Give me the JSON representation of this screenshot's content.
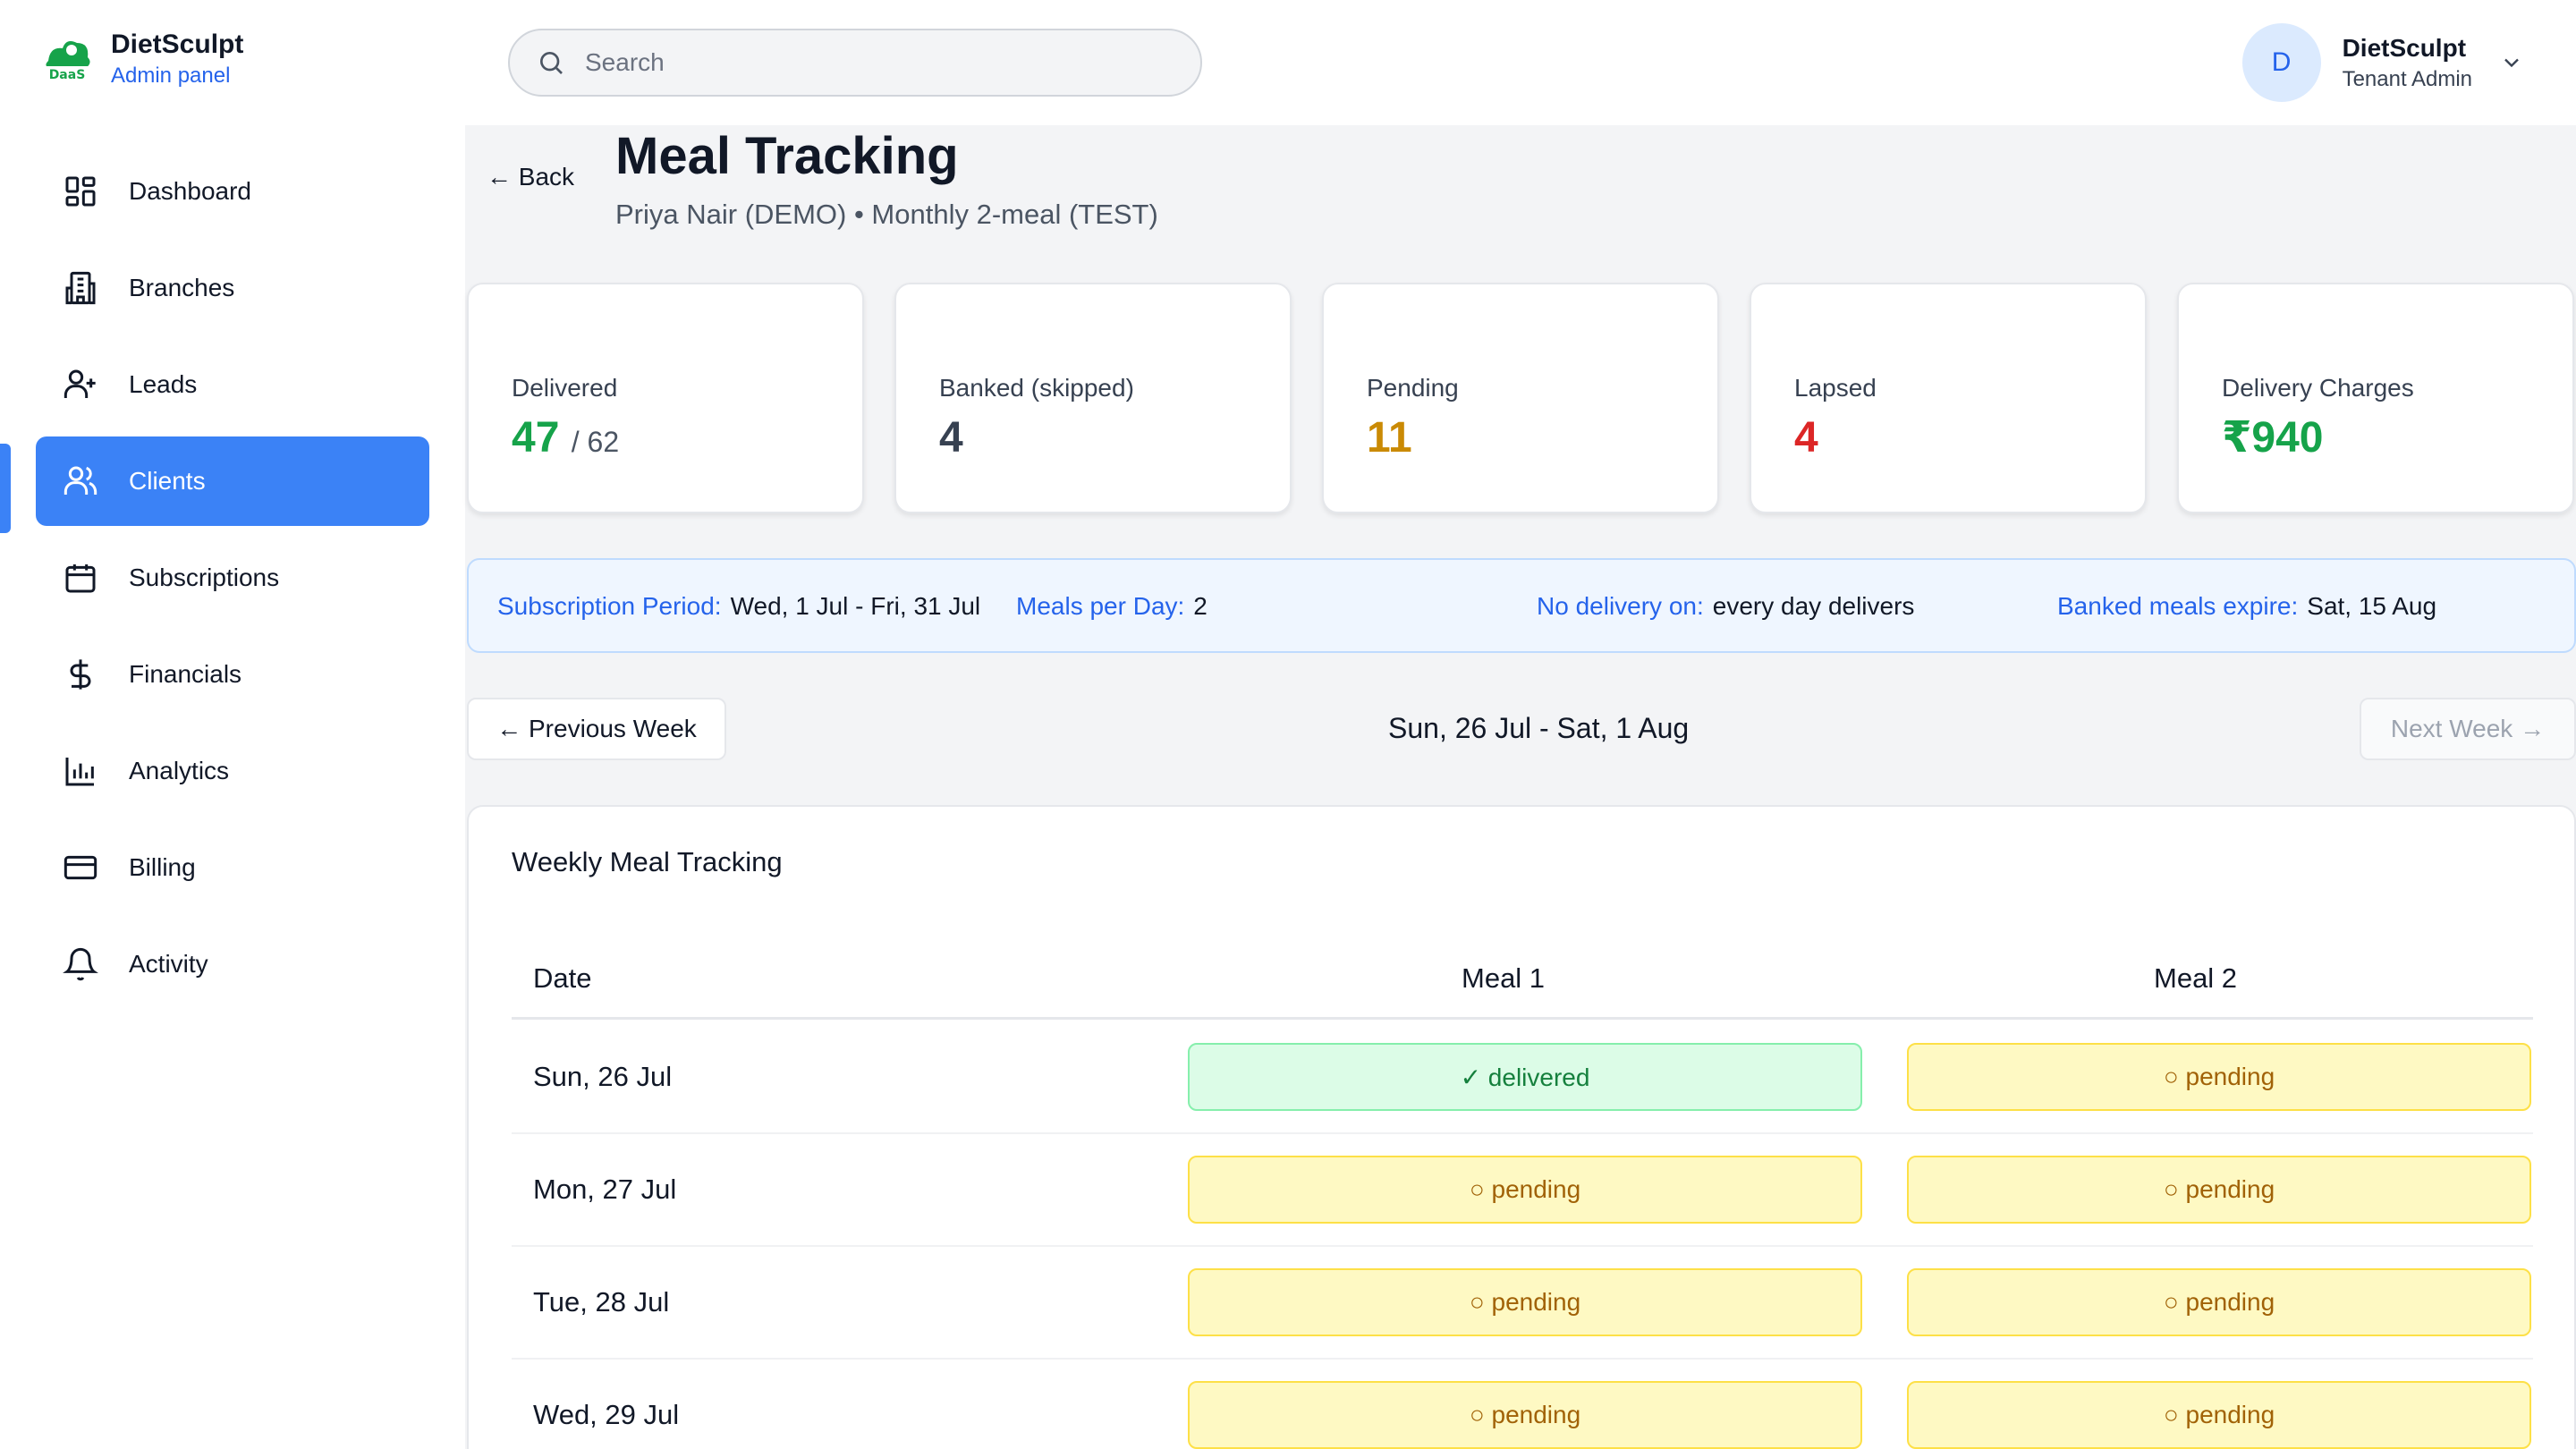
{
  "brand": {
    "name": "DietSculpt",
    "sub": "Admin panel"
  },
  "colors": {
    "primary": "#3b82f6",
    "delivered": "#16a34a",
    "banked": "#374151",
    "pending": "#ca8a04",
    "lapsed": "#dc2626"
  },
  "sidebar": {
    "items": [
      {
        "label": "Dashboard",
        "icon": "dashboard-icon"
      },
      {
        "label": "Branches",
        "icon": "building-icon"
      },
      {
        "label": "Leads",
        "icon": "user-plus-icon"
      },
      {
        "label": "Clients",
        "icon": "users-icon",
        "active": true
      },
      {
        "label": "Subscriptions",
        "icon": "calendar-icon"
      },
      {
        "label": "Financials",
        "icon": "dollar-icon"
      },
      {
        "label": "Analytics",
        "icon": "bar-chart-icon"
      },
      {
        "label": "Billing",
        "icon": "credit-card-icon"
      },
      {
        "label": "Activity",
        "icon": "bell-icon"
      }
    ]
  },
  "search": {
    "placeholder": "Search"
  },
  "user": {
    "initial": "D",
    "name": "DietSculpt",
    "role": "Tenant Admin"
  },
  "page": {
    "back_label": "← Back",
    "title": "Meal Tracking",
    "subtitle": "Priya Nair (DEMO) • Monthly 2-meal (TEST)"
  },
  "stats": {
    "delivered": {
      "label": "Delivered",
      "value": "47",
      "total": "/ 62"
    },
    "banked": {
      "label": "Banked (skipped)",
      "value": "4"
    },
    "pending": {
      "label": "Pending",
      "value": "11"
    },
    "lapsed": {
      "label": "Lapsed",
      "value": "4"
    },
    "charges": {
      "label": "Delivery Charges",
      "value": "₹940"
    }
  },
  "info": {
    "period_label": "Subscription Period:",
    "period_value": "Wed, 1 Jul - Fri, 31 Jul",
    "meals_label": "Meals per Day:",
    "meals_value": "2",
    "nodelivery_label": "No delivery on:",
    "nodelivery_value": "every day delivers",
    "expire_label": "Banked meals expire:",
    "expire_value": "Sat, 15 Aug"
  },
  "week": {
    "prev_label": "← Previous Week",
    "range": "Sun, 26 Jul - Sat, 1 Aug",
    "next_label": "Next Week →"
  },
  "table": {
    "title": "Weekly Meal Tracking",
    "headers": {
      "date": "Date",
      "meal1": "Meal 1",
      "meal2": "Meal 2"
    },
    "rows": [
      {
        "date": "Sun, 26 Jul",
        "meal1": "✓ delivered",
        "meal2": "○ pending"
      },
      {
        "date": "Mon, 27 Jul",
        "meal1": "○ pending",
        "meal2": "○ pending"
      },
      {
        "date": "Tue, 28 Jul",
        "meal1": "○ pending",
        "meal2": "○ pending"
      },
      {
        "date": "Wed, 29 Jul",
        "meal1": "○ pending",
        "meal2": "○ pending"
      }
    ]
  }
}
